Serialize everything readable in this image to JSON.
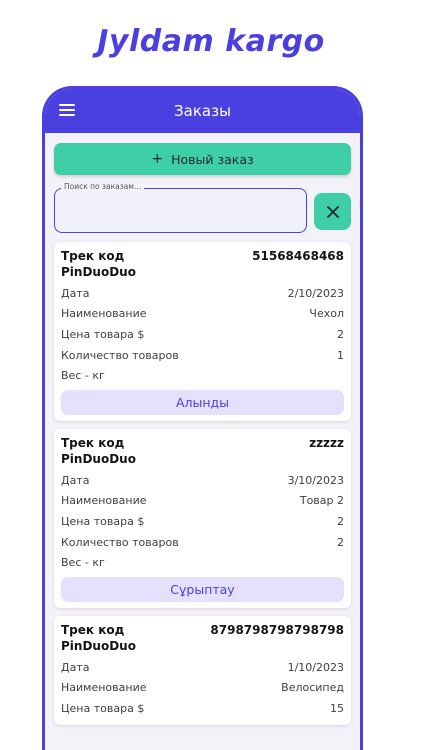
{
  "promo": {
    "title": "Jyldam kargo"
  },
  "appbar": {
    "title": "Заказы"
  },
  "new_order": {
    "label": "Новый заказ"
  },
  "search": {
    "label": "Поиск по заказам...",
    "value": ""
  },
  "icons": {
    "menu": "menu-icon",
    "plus": "plus-icon",
    "close": "close-icon"
  },
  "colors": {
    "brand": "#4b3fe0",
    "accent": "#3ecfa9",
    "status_bg": "#e4e0fd"
  },
  "orders": [
    {
      "track_label": "Трек код",
      "track_code": "51568468468",
      "platform": "PinDuoDuo",
      "rows": [
        {
          "label": "Дата",
          "value": "2/10/2023"
        },
        {
          "label": "Наименование",
          "value": "Чехол"
        },
        {
          "label": "Цена товара $",
          "value": "2"
        },
        {
          "label": "Количество товаров",
          "value": "1"
        },
        {
          "label": "Вес - кг",
          "value": ""
        }
      ],
      "status": "Алынды"
    },
    {
      "track_label": "Трек код",
      "track_code": "zzzzz",
      "platform": "PinDuoDuo",
      "rows": [
        {
          "label": "Дата",
          "value": "3/10/2023"
        },
        {
          "label": "Наименование",
          "value": "Товар 2"
        },
        {
          "label": "Цена товара $",
          "value": "2"
        },
        {
          "label": "Количество товаров",
          "value": "2"
        },
        {
          "label": "Вес - кг",
          "value": ""
        }
      ],
      "status": "Сұрыптау"
    },
    {
      "track_label": "Трек код",
      "track_code": "8798798798798798",
      "platform": "PinDuoDuo",
      "rows": [
        {
          "label": "Дата",
          "value": "1/10/2023"
        },
        {
          "label": "Наименование",
          "value": "Велосипед"
        },
        {
          "label": "Цена товара $",
          "value": "15"
        }
      ]
    }
  ]
}
